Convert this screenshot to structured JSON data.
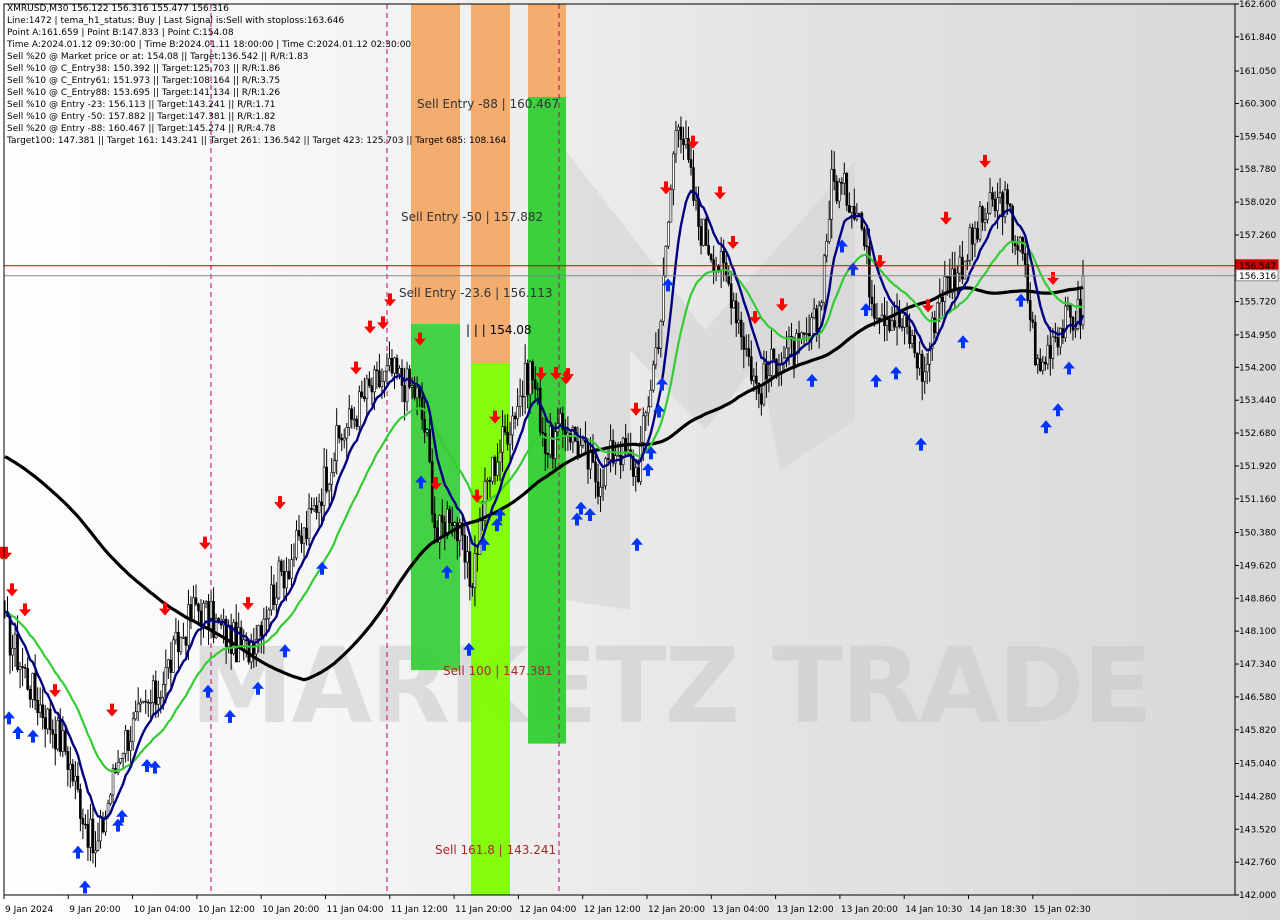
{
  "info_lines": [
    "XMRUSD,M30  156.122 156.316 155.477 156.316",
    "Line:1472 | tema_h1_status: Buy | Last Signal is:Sell with stoploss:163.646",
    "Point A:161.659 | Point B:147.833 | Point C:154.08",
    "Time A:2024.01.12 09:30:00 | Time B:2024.01.11 18:00:00 | Time C:2024.01.12 02:30:00",
    "Sell %20 @ Market price or at: 154.08 || Target:136.542 || R/R:1.83",
    "Sell %10 @ C_Entry38: 150.392 || Target:125.703 || R/R:1.86",
    "Sell %10 @ C_Entry61: 151.973 || Target:108.164 || R/R:3.75",
    "Sell %10 @ C_Entry88: 153.695 || Target:141.134 || R/R:1.26",
    "Sell %10 @ Entry -23: 156.113 || Target:143.241 || R/R:1.71",
    "Sell %10 @ Entry -50: 157.882 || Target:147.381 || R/R:1.82",
    "Sell %20 @ Entry -88: 160.467 || Target:145.274 || R/R:4.78",
    "Target100: 147.381 || Target 161: 143.241 || Target 261: 136.542 || Target 423: 125.703 || Target 685: 108.164"
  ],
  "chart_data": {
    "type": "candlestick",
    "symbol": "XMRUSD",
    "timeframe": "M30",
    "ylim": [
      142.0,
      162.6
    ],
    "price_ticks": [
      "162.600",
      "161.840",
      "161.050",
      "160.300",
      "159.540",
      "158.780",
      "158.020",
      "157.260",
      "156.547",
      "156.316",
      "155.720",
      "154.950",
      "154.200",
      "153.440",
      "152.680",
      "151.920",
      "151.160",
      "150.380",
      "149.620",
      "148.860",
      "148.100",
      "147.340",
      "146.580",
      "145.820",
      "145.040",
      "144.280",
      "143.520",
      "142.760",
      "142.000"
    ],
    "time_labels": [
      "9 Jan 2024",
      "9 Jan 20:00",
      "10 Jan 04:00",
      "10 Jan 12:00",
      "10 Jan 20:00",
      "11 Jan 04:00",
      "11 Jan 12:00",
      "11 Jan 20:00",
      "12 Jan 04:00",
      "12 Jan 12:00",
      "12 Jan 20:00",
      "13 Jan 04:00",
      "13 Jan 12:00",
      "13 Jan 20:00",
      "14 Jan 10:30",
      "14 Jan 18:30",
      "15 Jan 02:30"
    ],
    "current_price": 156.316,
    "current_price_label": "156.316",
    "red_line_price": 156.547,
    "red_line_label": "156.547",
    "zone_labels": {
      "entry88": "Sell Entry -88 | 160.467",
      "entry50": "Sell Entry -50 | 157.882",
      "entry23": "Sell Entry -23.6 | 156.113",
      "entry_c": "| | | 154.08",
      "sell100": "Sell 100 | 147.381",
      "sell161": "Sell 161.8 | 143.241"
    },
    "watermark": "MARKETZ TRADE",
    "colors": {
      "bull": "#000000",
      "bear": "#000000",
      "ma_slow": "#000000",
      "ma_mid": "#33cc33",
      "ma_fast": "#000080",
      "zone_orange": "#f4a460",
      "zone_green": "#32cd32",
      "zone_lime": "#7cfc00",
      "current_price_line": "#cc0000",
      "buy_arrow": "#0033ff",
      "sell_arrow": "#ff0000"
    }
  }
}
